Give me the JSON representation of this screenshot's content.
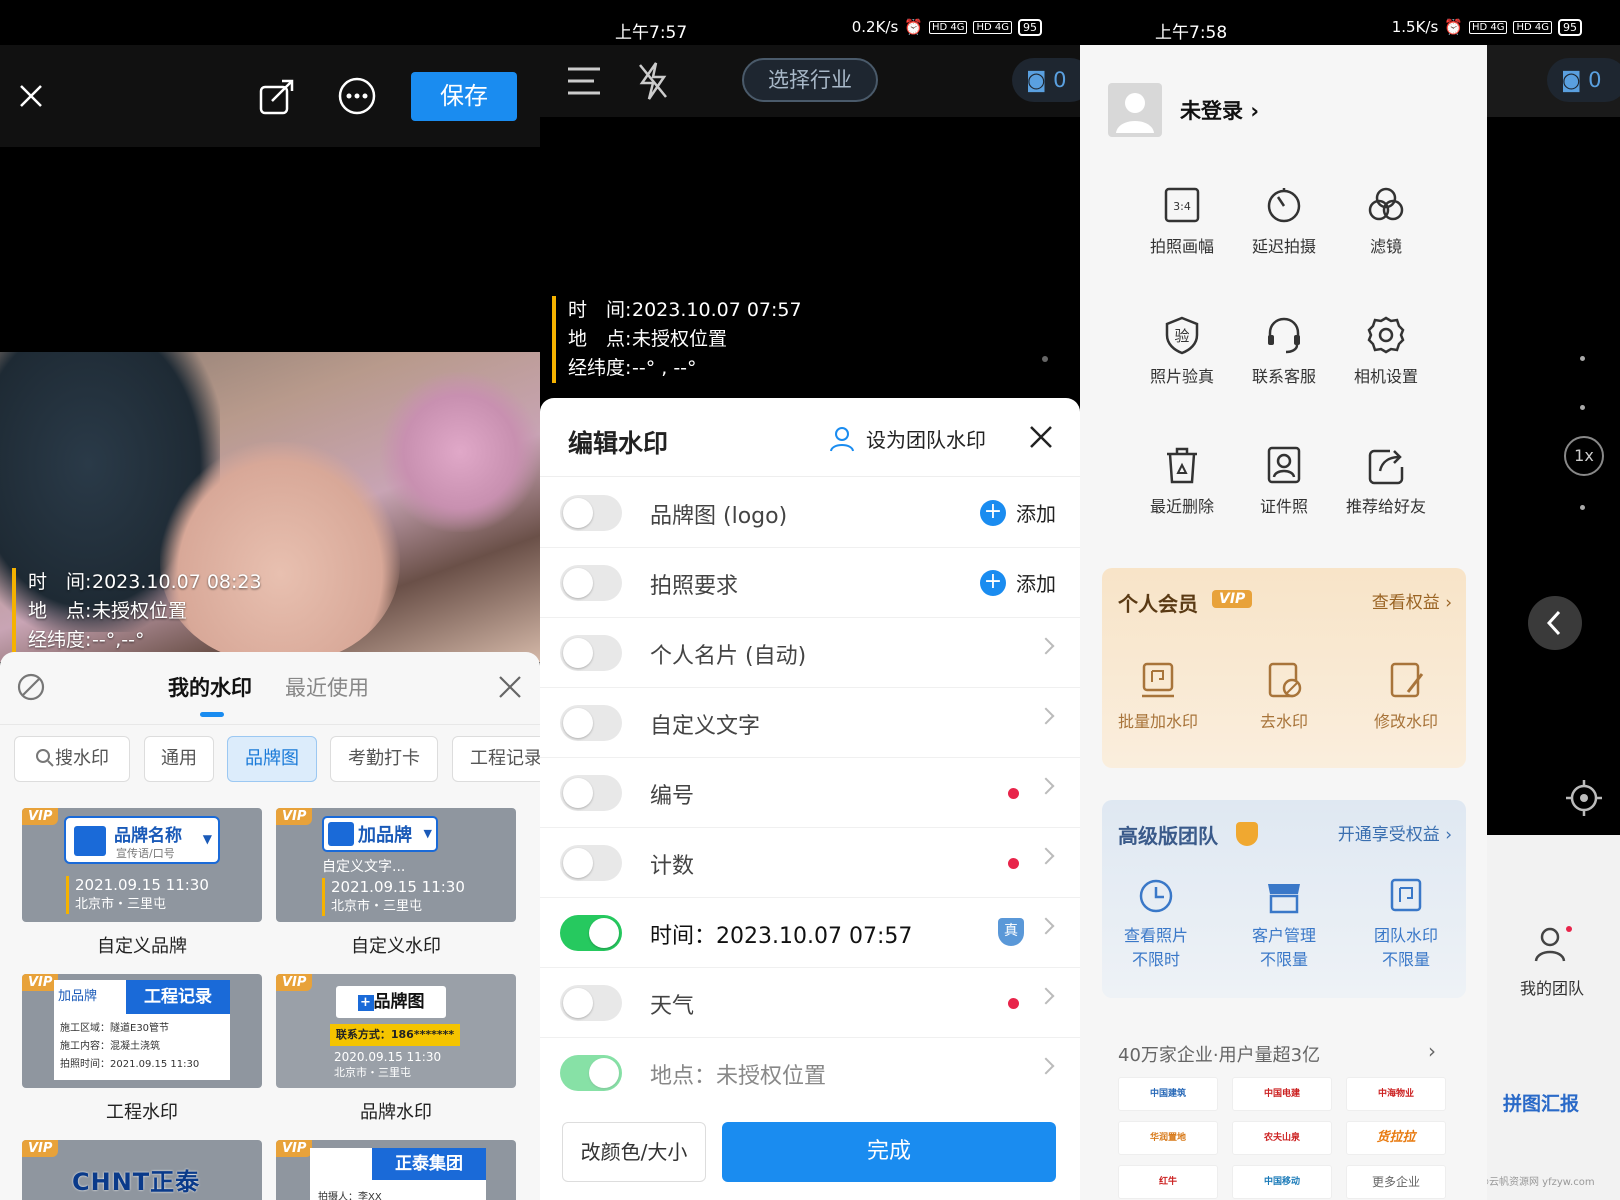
{
  "panel1": {
    "save_label": "保存",
    "watermark": {
      "time_key": "时　间:",
      "time_val": "2023.10.07 08:23",
      "place_key": "地　点:",
      "place_val": "未授权位置",
      "coord_key": "经纬度:",
      "coord_val": "--°,--°"
    },
    "tabs": [
      "我的水印",
      "最近使用"
    ],
    "chips": [
      "搜水印",
      "通用",
      "品牌图",
      "考勤打卡",
      "工程记录"
    ],
    "cards": [
      {
        "caption": "自定义品牌",
        "brand": "品牌名称",
        "slogan": "宣传语/口号",
        "date": "2021.09.15  11:30",
        "place": "北京市・三里屯"
      },
      {
        "caption": "自定义水印",
        "brand": "加品牌",
        "text": "自定义文字...",
        "date": "2021.09.15  11:30",
        "place": "北京市・三里屯"
      },
      {
        "caption": "工程水印",
        "brand": "加品牌",
        "title": "工程记录",
        "l1": "施工区域：隧道E30管节",
        "l2": "施工内容：混凝土浇筑",
        "l3": "拍照时间：2021.09.15 11:30"
      },
      {
        "caption": "品牌水印",
        "title": "品牌图",
        "contact": "联系方式：186*******",
        "date": "2020.09.15  11:30",
        "place": "北京市・三里屯"
      },
      {
        "brand": "CHNT正泰"
      },
      {
        "brand": "正泰集团",
        "sub": "拍摄人：李XX"
      }
    ],
    "vip": "VIP"
  },
  "panel2": {
    "status_time": "上午7:57",
    "status_speed": "0.2K/s",
    "battery": "95",
    "industry_btn": "选择行业",
    "photo_count": "0",
    "watermark": {
      "time_key": "时　间:",
      "time_val": "2023.10.07 07:57",
      "place_key": "地　点:",
      "place_val": "未授权位置",
      "coord_key": "经纬度:",
      "coord_val": "--° , --°"
    },
    "sheet_title": "编辑水印",
    "team_label": "设为团队水印",
    "add_label": "添加",
    "rows": [
      {
        "label": "品牌图 (logo)"
      },
      {
        "label": "拍照要求"
      },
      {
        "label": "个人名片 (自动)"
      },
      {
        "label": "自定义文字"
      },
      {
        "label": "编号"
      },
      {
        "label": "计数"
      },
      {
        "label": "时间：2023.10.07 07:57"
      },
      {
        "label": "天气"
      },
      {
        "label": "地点：未授权位置"
      }
    ],
    "verify_badge": "真",
    "color_btn": "改颜色/大小",
    "done_btn": "完成"
  },
  "panel3": {
    "status_time": "上午7:58",
    "status_speed": "1.5K/s",
    "battery": "95",
    "login": "未登录",
    "photo_count": "0",
    "zoom": "1x",
    "grid": [
      {
        "label": "拍照画幅",
        "icon": "aspect-ratio-icon"
      },
      {
        "label": "延迟拍摄",
        "icon": "timer-icon"
      },
      {
        "label": "滤镜",
        "icon": "filter-icon"
      },
      {
        "label": "照片验真",
        "icon": "verify-shield-icon"
      },
      {
        "label": "联系客服",
        "icon": "headset-icon"
      },
      {
        "label": "相机设置",
        "icon": "gear-icon"
      },
      {
        "label": "最近删除",
        "icon": "trash-icon"
      },
      {
        "label": "证件照",
        "icon": "id-photo-icon"
      },
      {
        "label": "推荐给好友",
        "icon": "share-icon"
      }
    ],
    "aspect_text": "3:4",
    "verify_text": "验",
    "vip_card": {
      "title": "个人会员",
      "badge": "VIP",
      "link": "查看权益",
      "items": [
        "批量加水印",
        "去水印",
        "修改水印"
      ]
    },
    "team_card": {
      "title": "高级版团队",
      "link": "开通享受权益",
      "items": [
        [
          "查看照片",
          "不限时"
        ],
        [
          "客户管理",
          "不限量"
        ],
        [
          "团队水印",
          "不限量"
        ]
      ]
    },
    "enterprise": "40万家企业·用户量超3亿",
    "logos": [
      "中国建筑",
      "中国电建",
      "中海物业",
      "华润置地",
      "农夫山泉",
      "货拉拉",
      "红牛",
      "中国移动",
      "更多企业"
    ],
    "my_team": "我的团队",
    "report": "拼图汇报",
    "footer_mark": "@云帆资源网 yfzyw.com"
  },
  "colors": {
    "accent": "#1a8cf0",
    "toggle_on": "#26c95f",
    "gold": "#f5b200",
    "vip_brown": "#8a5a1c",
    "team_blue": "#3a6fb0"
  }
}
